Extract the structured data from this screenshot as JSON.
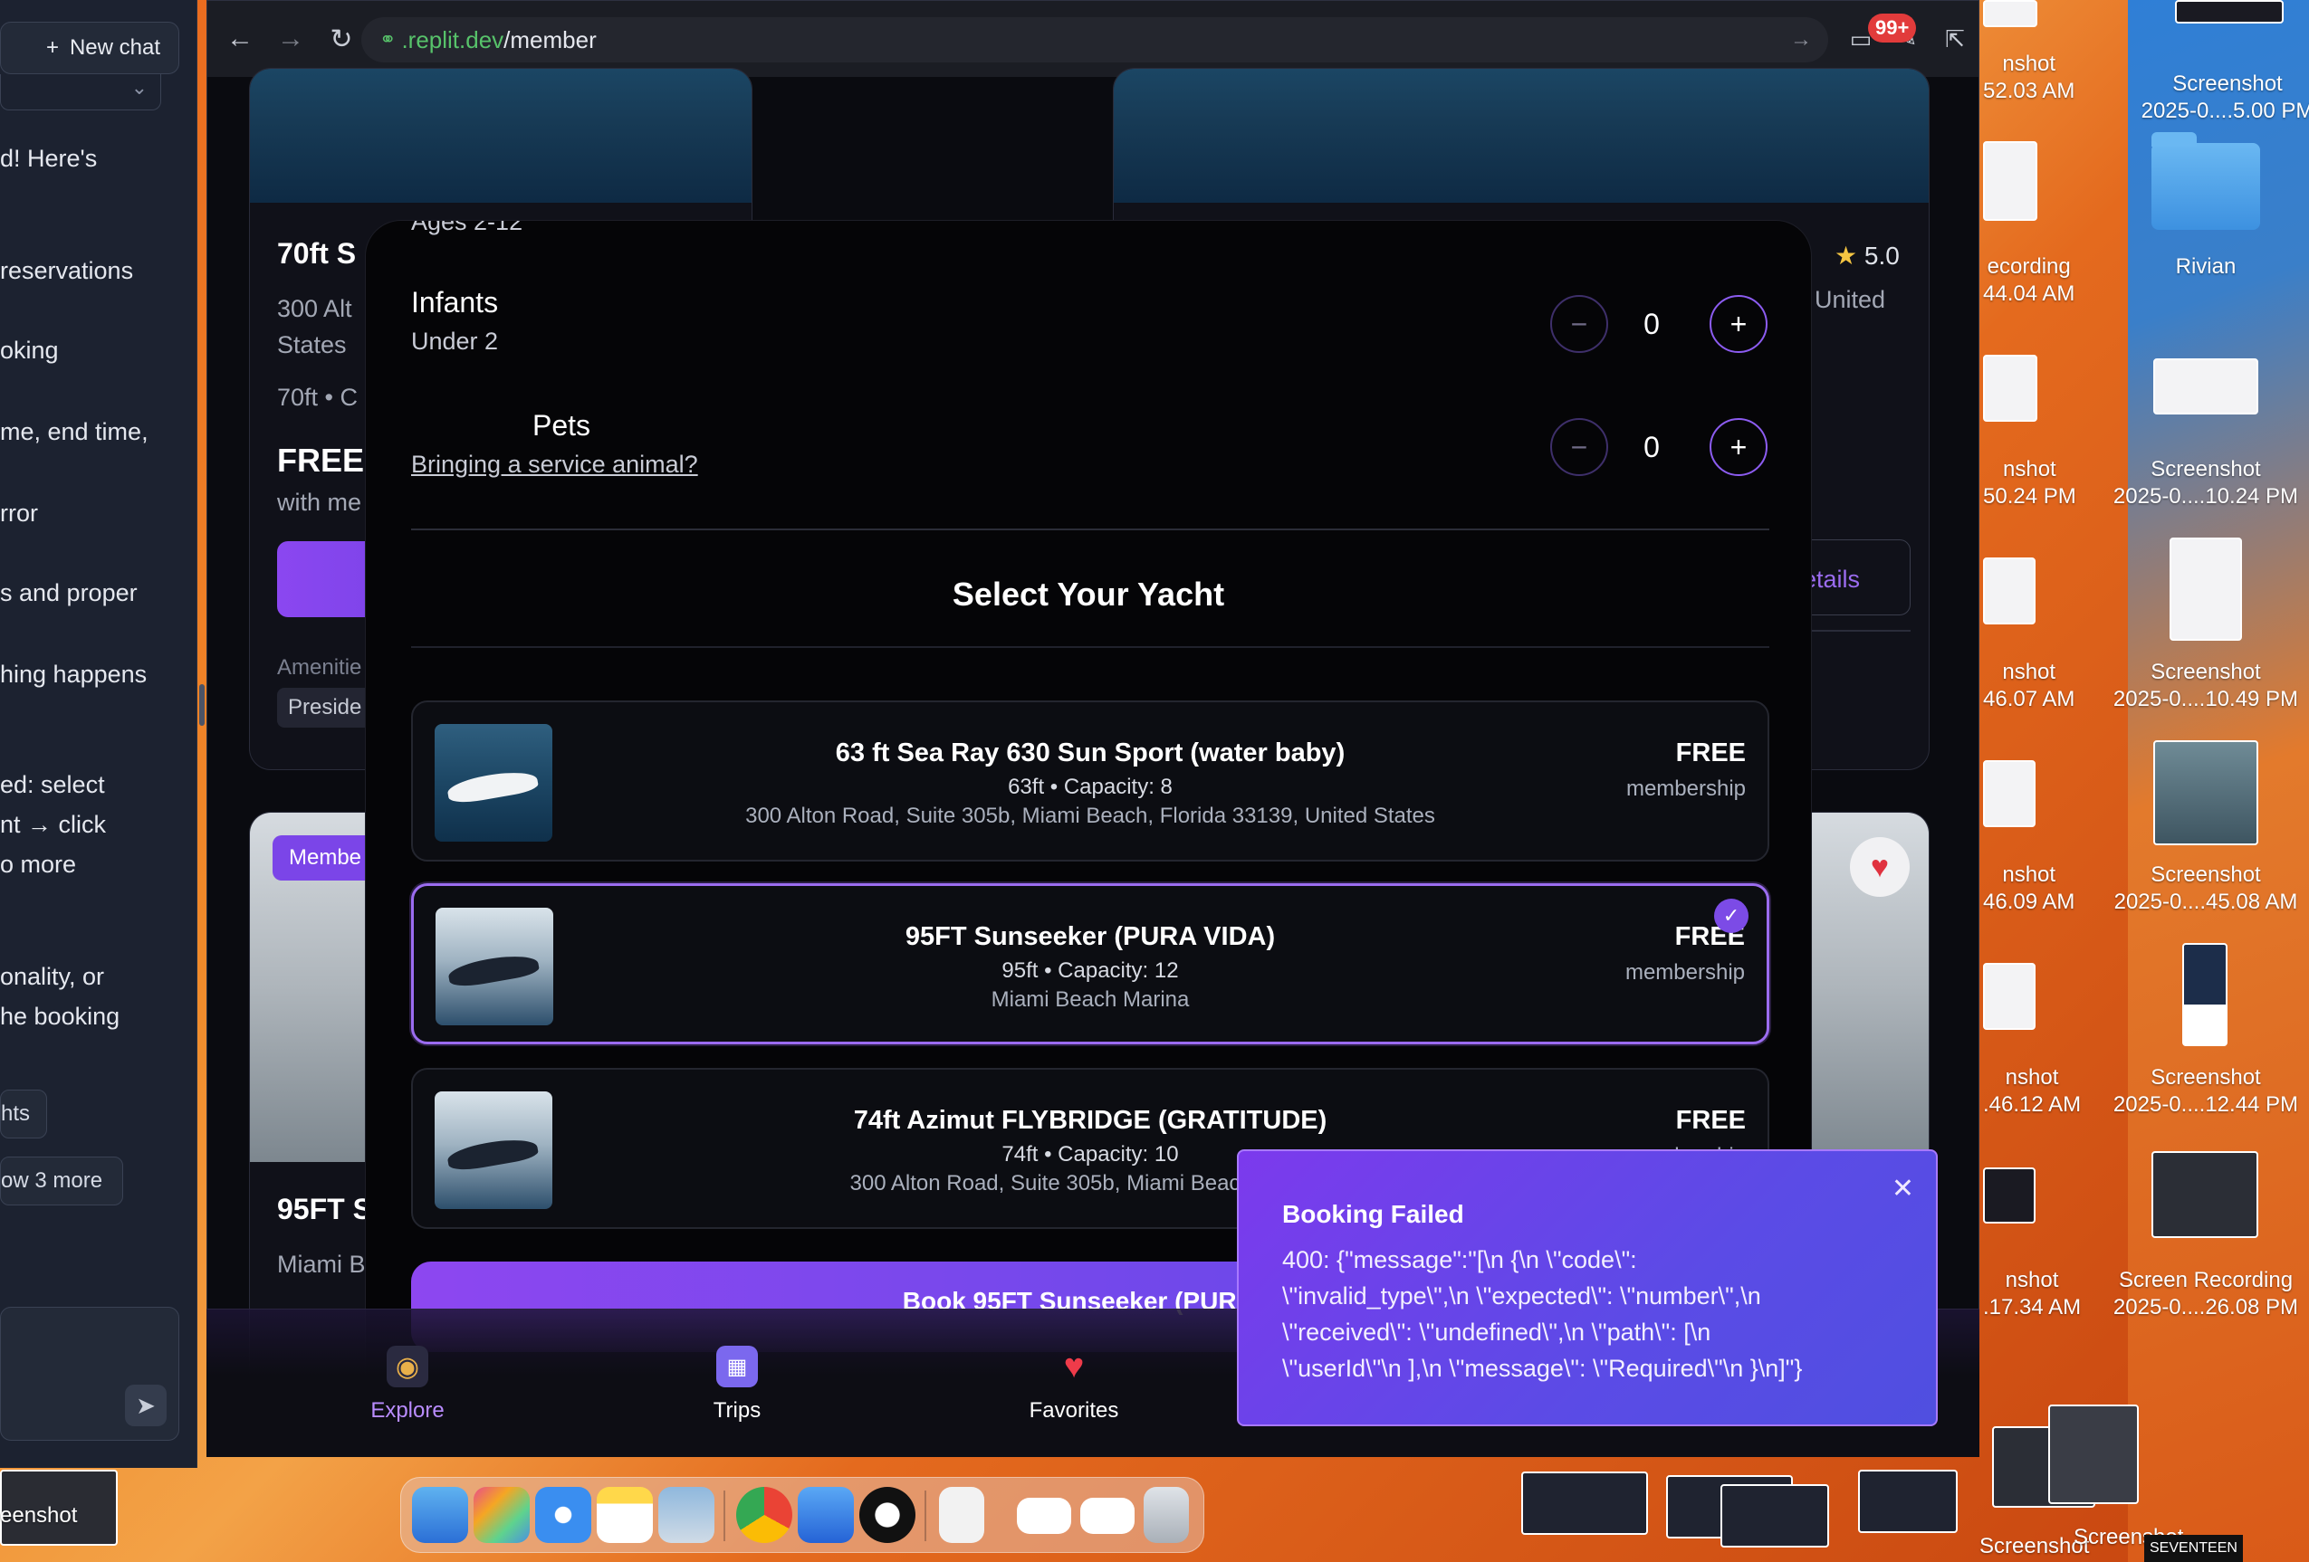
{
  "chat": {
    "new_chat_label": "New chat",
    "lines": [
      "d! Here's",
      "reservations",
      "oking",
      "me, end time,",
      "rror",
      "s and proper",
      "hing happens",
      "ed: select",
      "nt → click",
      "o more",
      "onality, or",
      "he booking"
    ],
    "chip1": "hts",
    "chip2": "ow 3 more"
  },
  "browser": {
    "url_domain": ".replit.dev",
    "url_path": "/member",
    "notification_badge": "99+"
  },
  "page": {
    "card1_title": "70ft S",
    "card1_loc1": "300 Alt",
    "card1_loc2": "States",
    "card1_meta": "70ft • C",
    "card1_price": "FREE",
    "card1_with": "with me",
    "card1_amenities": "Amenitie",
    "card1_amenity_chip": "Preside",
    "card2_rating": "5.0",
    "card2_loc": "United",
    "card2_details": "etails",
    "card3_tag": "Membe",
    "card3_title": "95FT S",
    "card3_loc": "Miami B"
  },
  "modal": {
    "ages_text": "Ages 2-12",
    "infants_label": "Infants",
    "infants_sub": "Under 2",
    "infants_value": "0",
    "pets_label": "Pets",
    "pets_value": "0",
    "service_animal_link": "Bringing a service animal?",
    "select_title": "Select Your Yacht",
    "yachts": [
      {
        "name": "63 ft Sea Ray 630 Sun Sport (water baby)",
        "meta": "63ft • Capacity: 8",
        "location": "300 Alton Road, Suite 305b, Miami Beach, Florida 33139, United States",
        "price": "FREE",
        "per": "membership"
      },
      {
        "name": "95FT Sunseeker (PURA VIDA)",
        "meta": "95ft • Capacity: 12",
        "location": "Miami Beach Marina",
        "price": "FREE",
        "per": "membership"
      },
      {
        "name": "74ft Azimut FLYBRIDGE (GRATITUDE)",
        "meta": "74ft • Capacity: 10",
        "location": "300 Alton Road, Suite 305b, Miami Beach, Florida",
        "price": "FREE",
        "per": "membership"
      }
    ],
    "book_button": "Book 95FT Sunseeker (PURA V"
  },
  "bottom_nav": [
    {
      "label": "Explore",
      "icon": "captain-hat-icon",
      "active": true
    },
    {
      "label": "Trips",
      "icon": "calendar-icon",
      "active": false
    },
    {
      "label": "Favorites",
      "icon": "heart-icon",
      "active": false
    }
  ],
  "toast": {
    "title": "Booking Failed",
    "message": "400: {\"message\":\"[\\n {\\n \\\"code\\\":\n\\\"invalid_type\\\",\\n \\\"expected\\\": \\\"number\\\",\\n\n\\\"received\\\": \\\"undefined\\\",\\n \\\"path\\\": [\\n\n\\\"userId\\\"\\n ],\\n \\\"message\\\": \\\"Required\\\"\\n }\\n]\"}"
  },
  "desktop": {
    "items": [
      {
        "label1": "nshot",
        "label2": "52.03 AM"
      },
      {
        "label1": "Screenshot",
        "label2": "2025-0....5.00 PM"
      },
      {
        "label1": "ecording",
        "label2": "44.04 AM"
      },
      {
        "label1": "Rivian",
        "label2": ""
      },
      {
        "label1": "nshot",
        "label2": "50.24 PM"
      },
      {
        "label1": "Screenshot",
        "label2": "2025-0....10.24 PM"
      },
      {
        "label1": "nshot",
        "label2": "46.07 AM"
      },
      {
        "label1": "Screenshot",
        "label2": "2025-0....10.49 PM"
      },
      {
        "label1": "nshot",
        "label2": "46.09 AM"
      },
      {
        "label1": "Screenshot",
        "label2": "2025-0....45.08 AM"
      },
      {
        "label1": "nshot",
        "label2": ".46.12 AM"
      },
      {
        "label1": "Screenshot",
        "label2": "2025-0....12.44 PM"
      },
      {
        "label1": "nshot",
        "label2": ".17.34 AM"
      },
      {
        "label1": "Screen Recording",
        "label2": "2025-0....26.08 PM"
      }
    ],
    "bottom_labels": [
      "eenshot",
      "Screenshot",
      "Screenshot",
      "SEVENTEEN"
    ]
  },
  "colors": {
    "accent": "#8b47f0",
    "toast": "#6b3fe6",
    "error_badge": "#e23b3b"
  }
}
